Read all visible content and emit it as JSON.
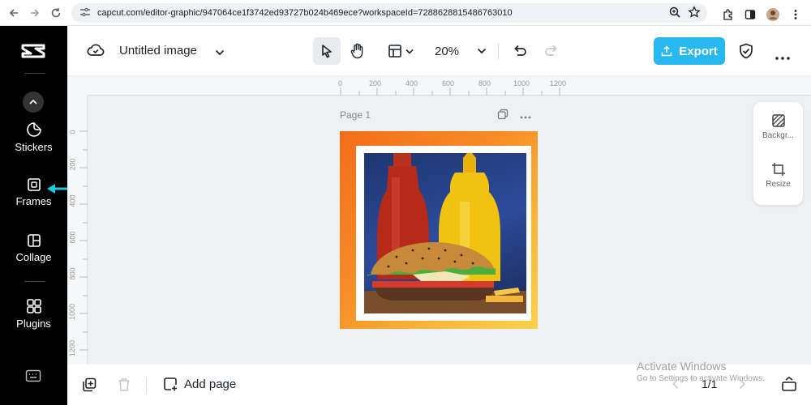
{
  "browser": {
    "url": "capcut.com/editor-graphic/947064ce1f3742ed93727b024b469ece?workspaceId=7288628815486763010"
  },
  "sidebar": {
    "items": [
      {
        "label": "Stickers",
        "icon": "stickers-icon"
      },
      {
        "label": "Frames",
        "icon": "frames-icon"
      },
      {
        "label": "Collage",
        "icon": "collage-icon"
      },
      {
        "label": "Plugins",
        "icon": "plugins-icon"
      }
    ]
  },
  "toolbar": {
    "title": "Untitled image",
    "zoom": "20%",
    "export_label": "Export"
  },
  "canvas": {
    "page_label": "Page 1",
    "ruler_top": [
      "0",
      "200",
      "400",
      "600",
      "800",
      "1000",
      "1200"
    ],
    "ruler_left": [
      "0",
      "200",
      "400",
      "600",
      "800",
      "1000",
      "1200"
    ]
  },
  "right_panel": {
    "background_label": "Backgr...",
    "resize_label": "Resize"
  },
  "bottom": {
    "add_page_label": "Add page",
    "pager": "1/1"
  },
  "watermark": {
    "line1": "Activate Windows",
    "line2": "Go to Settings to activate Windows."
  },
  "colors": {
    "accent": "#26b8ee",
    "sidebar_bg": "#000000",
    "canvas_bg": "#eef0f3",
    "highlight_arrow": "#1ec8d8"
  }
}
